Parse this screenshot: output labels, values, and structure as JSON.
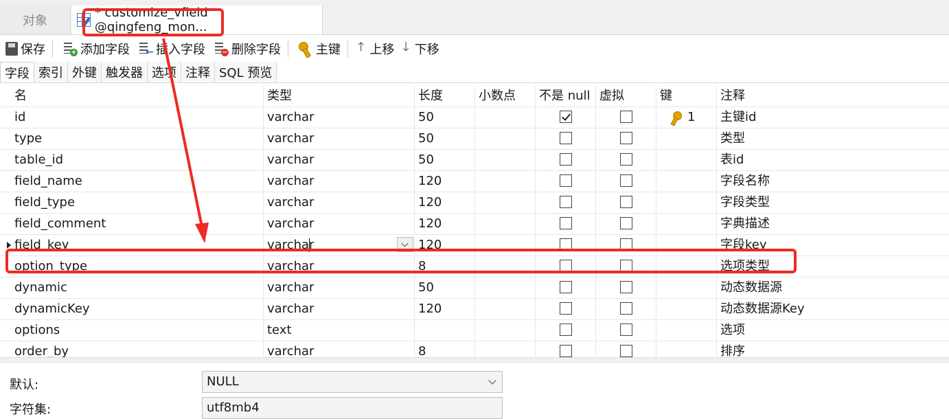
{
  "tabs": {
    "objects_label": "对象",
    "active_label": "* customize_vfield @qingfeng_mon..."
  },
  "toolbar": {
    "save": "保存",
    "add_field": "添加字段",
    "insert_field": "插入字段",
    "delete_field": "删除字段",
    "primary_key": "主键",
    "move_up": "上移",
    "move_down": "下移"
  },
  "subtabs": [
    "字段",
    "索引",
    "外键",
    "触发器",
    "选项",
    "注释",
    "SQL 预览"
  ],
  "columns": {
    "name": "名",
    "type": "类型",
    "length": "长度",
    "decimals": "小数点",
    "not_null": "不是 null",
    "virtual": "虚拟",
    "key": "键",
    "comment": "注释"
  },
  "rows": [
    {
      "name": "id",
      "type": "varchar",
      "length": "50",
      "not_null": true,
      "virtual": false,
      "key": "1",
      "comment": "主键id"
    },
    {
      "name": "type",
      "type": "varchar",
      "length": "50",
      "not_null": false,
      "virtual": false,
      "key": "",
      "comment": "类型"
    },
    {
      "name": "table_id",
      "type": "varchar",
      "length": "50",
      "not_null": false,
      "virtual": false,
      "key": "",
      "comment": "表id"
    },
    {
      "name": "field_name",
      "type": "varchar",
      "length": "120",
      "not_null": false,
      "virtual": false,
      "key": "",
      "comment": "字段名称"
    },
    {
      "name": "field_type",
      "type": "varchar",
      "length": "120",
      "not_null": false,
      "virtual": false,
      "key": "",
      "comment": "字段类型"
    },
    {
      "name": "field_comment",
      "type": "varchar",
      "length": "120",
      "not_null": false,
      "virtual": false,
      "key": "",
      "comment": "字典描述"
    },
    {
      "name": "field_key",
      "type": "varchar",
      "length": "120",
      "not_null": false,
      "virtual": false,
      "key": "",
      "comment": "字段key"
    },
    {
      "name": "option_type",
      "type": "varchar",
      "length": "8",
      "not_null": false,
      "virtual": false,
      "key": "",
      "comment": "选项类型"
    },
    {
      "name": "dynamic",
      "type": "varchar",
      "length": "50",
      "not_null": false,
      "virtual": false,
      "key": "",
      "comment": "动态数据源"
    },
    {
      "name": "dynamicKey",
      "type": "varchar",
      "length": "120",
      "not_null": false,
      "virtual": false,
      "key": "",
      "comment": "动态数据源Key"
    },
    {
      "name": "options",
      "type": "text",
      "length": "",
      "not_null": false,
      "virtual": false,
      "key": "",
      "comment": "选项"
    },
    {
      "name": "order_by",
      "type": "varchar",
      "length": "8",
      "not_null": false,
      "virtual": false,
      "key": "",
      "comment": "排序"
    }
  ],
  "properties": {
    "default_label": "默认:",
    "default_value": "NULL",
    "charset_label": "字符集:",
    "charset_value": "utf8mb4"
  },
  "colors": {
    "annotation": "#ee2a24",
    "key_icon": "#e2a400"
  }
}
